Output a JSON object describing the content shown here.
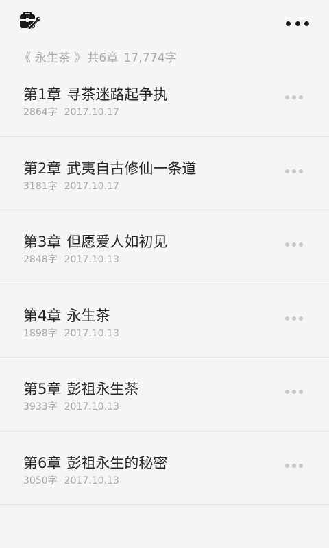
{
  "header": {
    "left_icon": "toolbox-icon",
    "right_icon": "more-horizontal-icon"
  },
  "summary": {
    "book_title": "《 永生茶 》",
    "chapter_count": "共6章",
    "word_count": "17,774字"
  },
  "chapters": [
    {
      "number": "第1章",
      "title": "寻茶迷路起争执",
      "words": "2864字",
      "date": "2017.10.17"
    },
    {
      "number": "第2章",
      "title": "武夷自古修仙一条道",
      "words": "3181字",
      "date": "2017.10.17"
    },
    {
      "number": "第3章",
      "title": "但愿爱人如初见",
      "words": "2848字",
      "date": "2017.10.13"
    },
    {
      "number": "第4章",
      "title": "永生茶",
      "words": "1898字",
      "date": "2017.10.13"
    },
    {
      "number": "第5章",
      "title": "彭祖永生茶",
      "words": "3933字",
      "date": "2017.10.13"
    },
    {
      "number": "第6章",
      "title": "彭祖永生的秘密",
      "words": "3050字",
      "date": "2017.10.13"
    }
  ],
  "colors": {
    "background": "#f5f5f5",
    "divider": "#e4e4e4",
    "title_text": "#262626",
    "secondary_text": "#a4a4a4",
    "row_more_dots": "#c8c8c8"
  }
}
